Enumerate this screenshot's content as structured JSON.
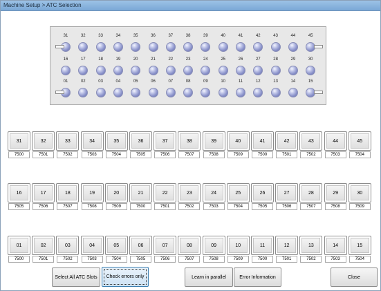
{
  "window": {
    "title": "Machine Setup > ATC Selection"
  },
  "magazine": {
    "top_row": [
      "31",
      "32",
      "33",
      "34",
      "35",
      "36",
      "37",
      "38",
      "39",
      "40",
      "41",
      "42",
      "43",
      "44",
      "45"
    ],
    "middle_row": [
      "16",
      "17",
      "18",
      "19",
      "20",
      "21",
      "22",
      "23",
      "24",
      "25",
      "26",
      "27",
      "28",
      "29",
      "30"
    ],
    "bottom_row": [
      "01",
      "02",
      "03",
      "04",
      "05",
      "06",
      "07",
      "08",
      "09",
      "10",
      "11",
      "12",
      "13",
      "14",
      "15"
    ]
  },
  "slots": {
    "row1": [
      {
        "label": "31",
        "value": "7500"
      },
      {
        "label": "32",
        "value": "7501"
      },
      {
        "label": "33",
        "value": "7502"
      },
      {
        "label": "34",
        "value": "7503"
      },
      {
        "label": "35",
        "value": "7504"
      },
      {
        "label": "36",
        "value": "7505"
      },
      {
        "label": "37",
        "value": "7506"
      },
      {
        "label": "38",
        "value": "7507"
      },
      {
        "label": "39",
        "value": "7508"
      },
      {
        "label": "40",
        "value": "7509"
      },
      {
        "label": "41",
        "value": "7500"
      },
      {
        "label": "42",
        "value": "7501"
      },
      {
        "label": "43",
        "value": "7502"
      },
      {
        "label": "44",
        "value": "7503"
      },
      {
        "label": "45",
        "value": "7504"
      }
    ],
    "row2": [
      {
        "label": "16",
        "value": "7505"
      },
      {
        "label": "17",
        "value": "7506"
      },
      {
        "label": "18",
        "value": "7507"
      },
      {
        "label": "19",
        "value": "7508"
      },
      {
        "label": "20",
        "value": "7509"
      },
      {
        "label": "21",
        "value": "7500"
      },
      {
        "label": "22",
        "value": "7501"
      },
      {
        "label": "23",
        "value": "7502"
      },
      {
        "label": "24",
        "value": "7503"
      },
      {
        "label": "25",
        "value": "7504"
      },
      {
        "label": "26",
        "value": "7505"
      },
      {
        "label": "27",
        "value": "7506"
      },
      {
        "label": "28",
        "value": "7507"
      },
      {
        "label": "29",
        "value": "7508"
      },
      {
        "label": "30",
        "value": "7509"
      }
    ],
    "row3": [
      {
        "label": "01",
        "value": "7500"
      },
      {
        "label": "02",
        "value": "7501"
      },
      {
        "label": "03",
        "value": "7502"
      },
      {
        "label": "04",
        "value": "7503"
      },
      {
        "label": "05",
        "value": "7504"
      },
      {
        "label": "06",
        "value": "7505"
      },
      {
        "label": "07",
        "value": "7506"
      },
      {
        "label": "08",
        "value": "7507"
      },
      {
        "label": "09",
        "value": "7508"
      },
      {
        "label": "10",
        "value": "7509"
      },
      {
        "label": "11",
        "value": "7500"
      },
      {
        "label": "12",
        "value": "7501"
      },
      {
        "label": "13",
        "value": "7502"
      },
      {
        "label": "14",
        "value": "7503"
      },
      {
        "label": "15",
        "value": "7504"
      }
    ]
  },
  "buttons": {
    "select_all": "Select All ATC Slots",
    "check_errors": "Check errors only",
    "learn_parallel": "Learn in parallel",
    "error_info": "Error Information",
    "close": "Close"
  },
  "colors": {
    "title_bar": "#86b1dc",
    "ball": "#9aa0d6",
    "focus": "#3c7fb1"
  }
}
